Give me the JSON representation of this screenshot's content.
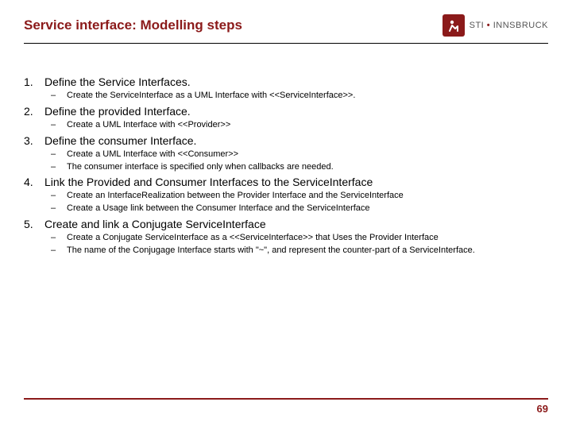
{
  "header": {
    "title": "Service interface: Modelling steps",
    "logo_text_pre": "STI",
    "logo_text_post": "INNSBRUCK"
  },
  "steps": [
    {
      "title": "Define the Service Interfaces.",
      "subs": [
        "Create the ServiceInterface as a UML Interface with <<ServiceInterface>>."
      ]
    },
    {
      "title": "Define the provided Interface.",
      "subs": [
        "Create a UML Interface with <<Provider>>"
      ]
    },
    {
      "title": "Define the consumer Interface.",
      "subs": [
        "Create a UML Interface with <<Consumer>>",
        "The consumer interface is specified only when callbacks are needed."
      ]
    },
    {
      "title": "Link the Provided and Consumer Interfaces to the ServiceInterface",
      "subs": [
        "Create an InterfaceRealization between the Provider Interface and the ServiceInterface",
        "Create a Usage link between the Consumer Interface and the ServiceInterface"
      ]
    },
    {
      "title": "Create and link a Conjugate ServiceInterface",
      "subs": [
        "Create a Conjugate ServiceInterface as a <<ServiceInterface>> that Uses the Provider Interface",
        "The name of the Conjugage Interface starts with \"~\", and represent the counter-part of a ServiceInterface."
      ]
    }
  ],
  "page_number": "69"
}
